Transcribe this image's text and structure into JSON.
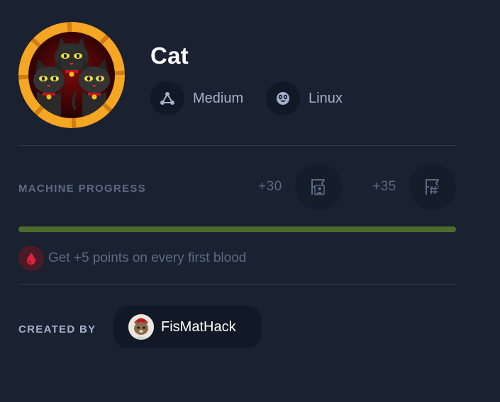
{
  "machine": {
    "name": "Cat",
    "difficulty": "Medium",
    "os": "Linux",
    "avatar_icon": "three-cats-avatar-icon"
  },
  "progress": {
    "label": "MACHINE PROGRESS",
    "user_points": "+30",
    "root_points": "+35",
    "fraction": 1.0,
    "bar_color": "#4e6b2e"
  },
  "first_blood": {
    "text": "Get +5 points on every first blood",
    "icon": "blood-drop-icon",
    "color": "#e0203c"
  },
  "creator": {
    "label": "CREATED BY",
    "name": "FisMatHack"
  },
  "colors": {
    "background": "#1a2130",
    "ring": "#f5a623"
  }
}
